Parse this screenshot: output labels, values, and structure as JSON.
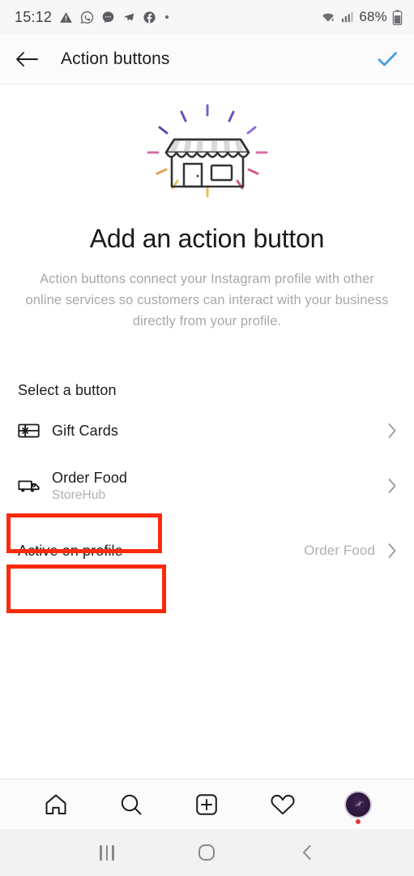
{
  "status_bar": {
    "time": "15:12",
    "left_icons": [
      "warning-triangle-icon",
      "whatsapp-icon",
      "messenger-chat-icon",
      "paper-plane-icon",
      "facebook-icon",
      "dot-icon"
    ],
    "battery_percent": "68%",
    "right_icons": [
      "wifi-icon",
      "cellular-signal-icon",
      "battery-icon"
    ]
  },
  "header": {
    "back_icon": "arrow-left-icon",
    "title": "Action buttons",
    "confirm_icon": "checkmark-icon",
    "confirm_color": "#4a9fe0"
  },
  "hero": {
    "illustration": "storefront-illustration",
    "title": "Add an action button",
    "description": "Action buttons connect your Instagram profile with other online services so customers can interact with your business directly from your profile."
  },
  "select_section": {
    "label": "Select a button",
    "options": [
      {
        "icon": "gift-card-icon",
        "title": "Gift Cards",
        "subtitle": "",
        "chevron": "chevron-right-icon",
        "highlighted": true
      },
      {
        "icon": "delivery-truck-icon",
        "title": "Order Food",
        "subtitle": "StoreHub",
        "chevron": "chevron-right-icon",
        "highlighted": true
      }
    ]
  },
  "active_row": {
    "label": "Active on profile",
    "value": "Order Food",
    "chevron": "chevron-right-icon"
  },
  "annotation": {
    "color": "#fc2a0c"
  },
  "tab_bar": {
    "items": [
      {
        "icon": "home-icon",
        "label": "Home"
      },
      {
        "icon": "search-icon",
        "label": "Search"
      },
      {
        "icon": "add-post-icon",
        "label": "Create"
      },
      {
        "icon": "heart-icon",
        "label": "Activity"
      },
      {
        "icon": "profile-avatar-icon",
        "label": "Profile"
      }
    ]
  },
  "android_nav": {
    "items": [
      {
        "icon": "recents-icon",
        "label": "Recents"
      },
      {
        "icon": "home-circle-icon",
        "label": "Home"
      },
      {
        "icon": "back-chevron-icon",
        "label": "Back"
      }
    ]
  }
}
